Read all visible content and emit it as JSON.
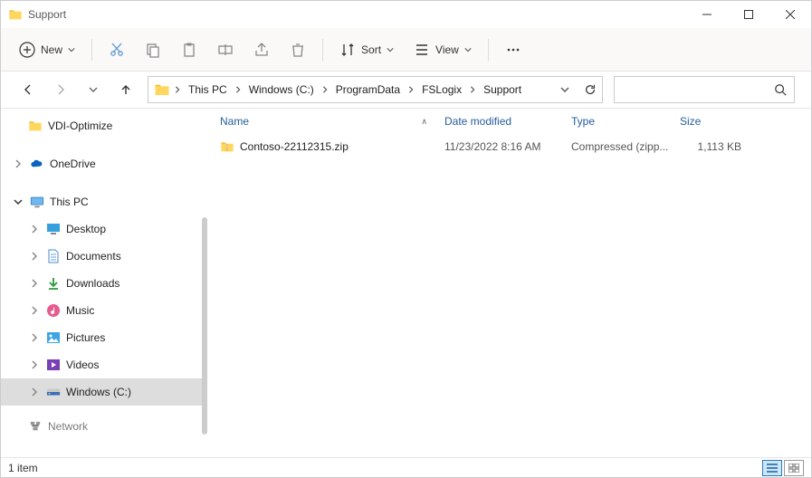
{
  "window": {
    "title": "Support"
  },
  "toolbar": {
    "new_label": "New",
    "sort_label": "Sort",
    "view_label": "View"
  },
  "breadcrumbs": {
    "items": [
      "This PC",
      "Windows (C:)",
      "ProgramData",
      "FSLogix",
      "Support"
    ]
  },
  "nav": {
    "quick": {
      "label": "VDI-Optimize"
    },
    "onedrive": {
      "label": "OneDrive"
    },
    "thispc": {
      "label": "This PC"
    },
    "desktop": {
      "label": "Desktop"
    },
    "documents": {
      "label": "Documents"
    },
    "downloads": {
      "label": "Downloads"
    },
    "music": {
      "label": "Music"
    },
    "pictures": {
      "label": "Pictures"
    },
    "videos": {
      "label": "Videos"
    },
    "cdrive": {
      "label": "Windows (C:)"
    },
    "network": {
      "label": "Network"
    }
  },
  "columns": {
    "name": "Name",
    "date": "Date modified",
    "type": "Type",
    "size": "Size"
  },
  "files": [
    {
      "name": "Contoso-22112315.zip",
      "date": "11/23/2022 8:16 AM",
      "type": "Compressed (zipp...",
      "size": "1,113 KB"
    }
  ],
  "status": {
    "count": "1 item"
  }
}
